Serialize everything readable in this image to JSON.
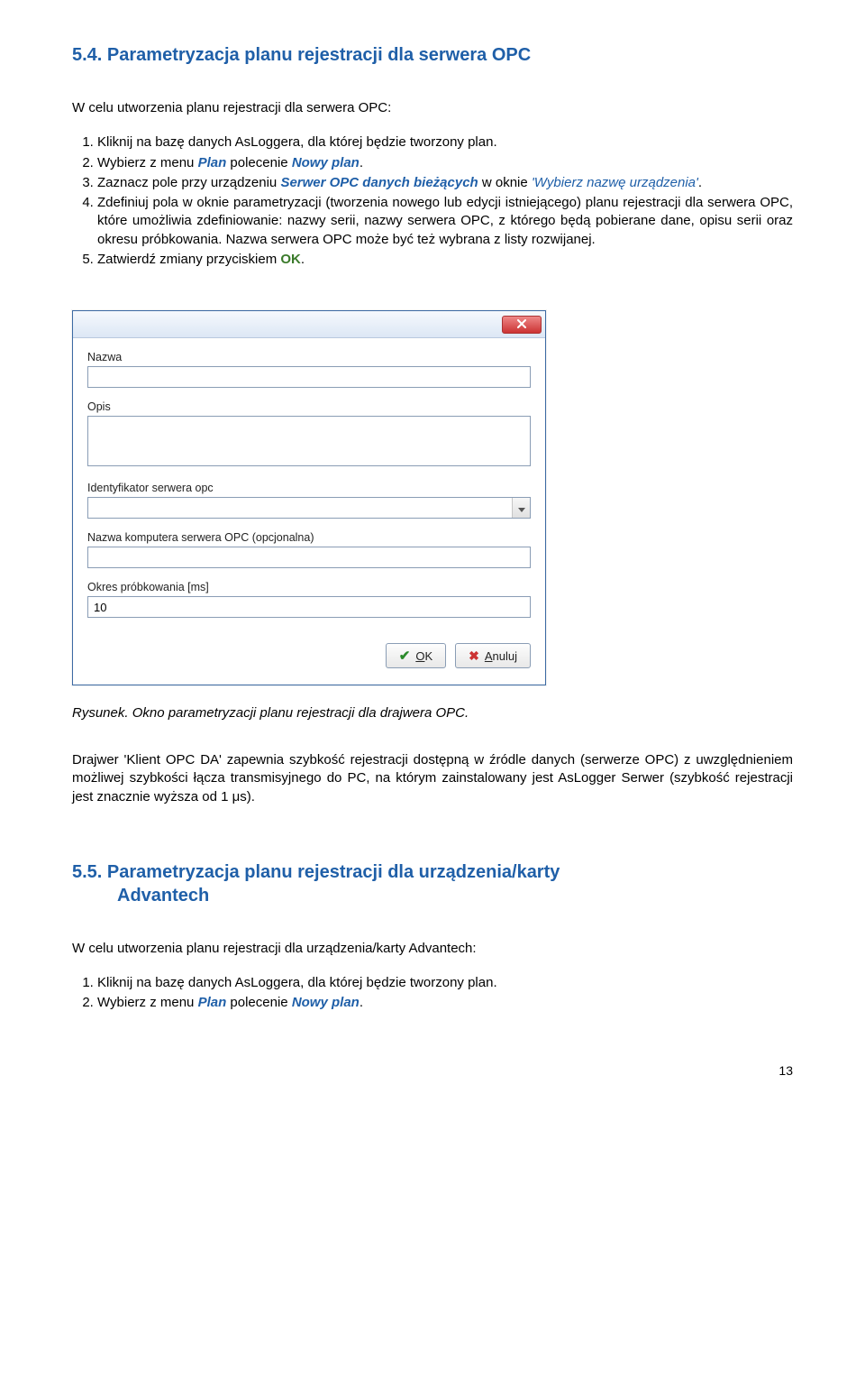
{
  "section1": {
    "title": "5.4. Parametryzacja planu rejestracji dla serwera OPC",
    "intro": "W celu utworzenia planu rejestracji dla serwera OPC:",
    "steps": {
      "s1": "Kliknij na bazę danych AsLoggera, dla której będzie tworzony plan.",
      "s2_a": "Wybierz z menu ",
      "s2_b": "Plan",
      "s2_c": " polecenie ",
      "s2_d": "Nowy plan",
      "s2_e": ".",
      "s3_a": "Zaznacz pole przy urządzeniu ",
      "s3_b": "Serwer OPC danych bieżących",
      "s3_c": " w oknie ",
      "s3_d": "'Wybierz nazwę urządzenia'",
      "s3_e": ".",
      "s4": "Zdefiniuj pola w oknie parametryzacji (tworzenia nowego lub edycji istniejącego) planu rejestracji dla serwera OPC, które umożliwia zdefiniowanie: nazwy serii, nazwy serwera OPC, z którego będą pobierane dane, opisu serii oraz okresu próbkowania. Nazwa serwera OPC może być też wybrana z listy rozwijanej.",
      "s5_a": "Zatwierdź zmiany przyciskiem ",
      "s5_b": "OK",
      "s5_c": "."
    }
  },
  "dialog": {
    "labels": {
      "nazwa": "Nazwa",
      "opis": "Opis",
      "ident": "Identyfikator serwera opc",
      "komputer": "Nazwa komputera serwera OPC (opcjonalna)",
      "okres": "Okres próbkowania [ms]"
    },
    "values": {
      "nazwa": "",
      "opis": "",
      "ident": "",
      "komputer": "",
      "okres": "10"
    },
    "buttons": {
      "ok_u": "O",
      "ok_rest": "K",
      "anuluj_u": "A",
      "anuluj_rest": "nuluj"
    }
  },
  "caption": "Rysunek. Okno parametryzacji planu rejestracji dla drajwera OPC.",
  "note": "Drajwer 'Klient OPC DA' zapewnia szybkość rejestracji dostępną w źródle danych (serwerze OPC) z uwzględnieniem możliwej szybkości łącza transmisyjnego do PC, na którym zainstalowany jest AsLogger Serwer (szybkość rejestracji jest znacznie wyższa od 1 μs).",
  "section2": {
    "title_l1": "5.5. Parametryzacja planu rejestracji dla urządzenia/karty",
    "title_l2": "Advantech",
    "intro": "W celu utworzenia planu rejestracji dla urządzenia/karty Advantech:",
    "steps": {
      "s1": "Kliknij na bazę danych AsLoggera, dla której będzie tworzony plan.",
      "s2_a": "Wybierz z menu ",
      "s2_b": "Plan",
      "s2_c": " polecenie ",
      "s2_d": "Nowy plan",
      "s2_e": "."
    }
  },
  "page_no": "13"
}
